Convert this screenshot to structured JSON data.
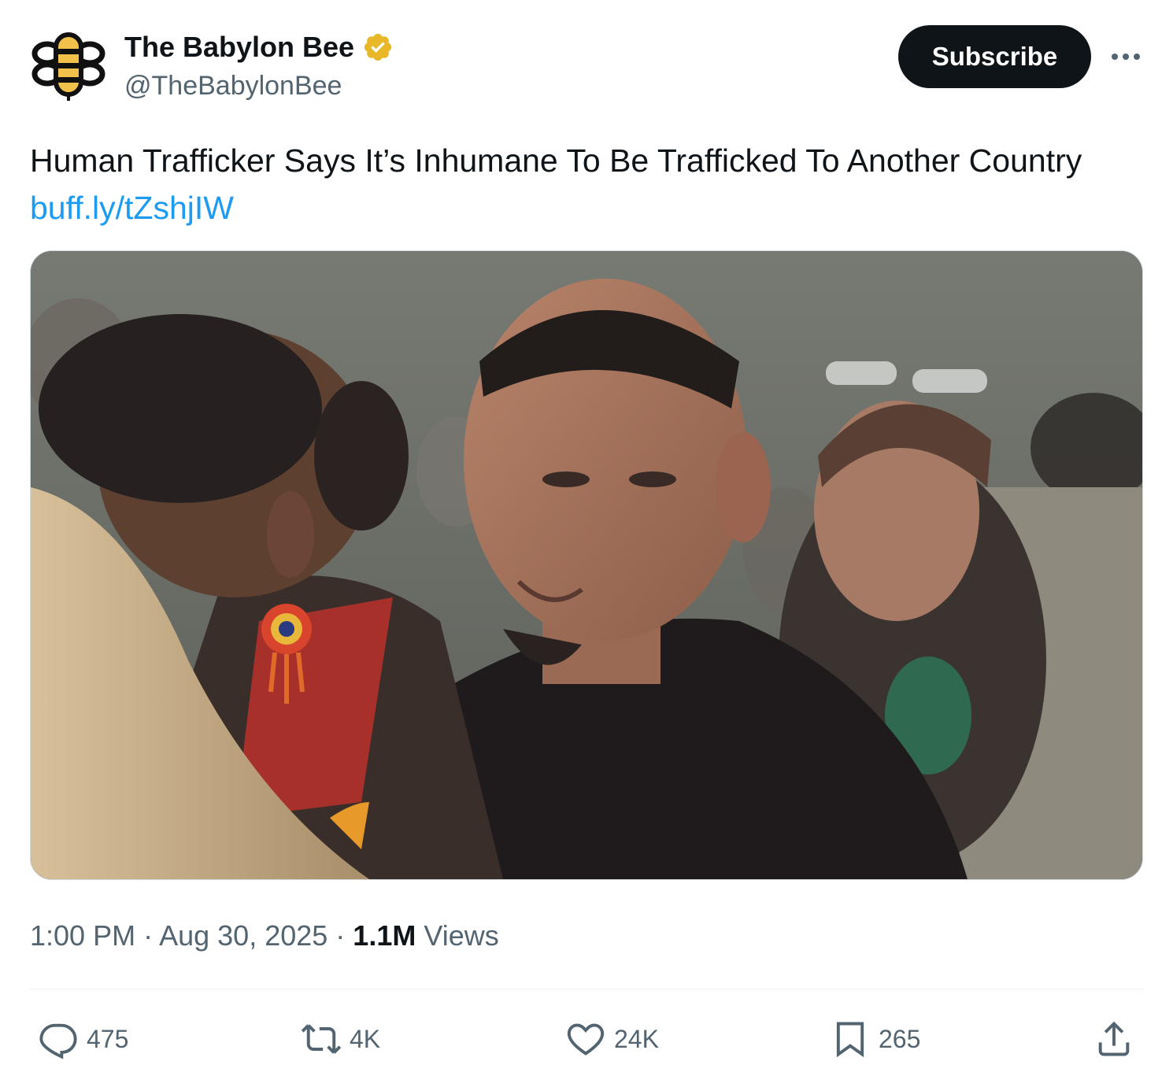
{
  "author": {
    "display_name": "The Babylon Bee",
    "handle": "@TheBabylonBee",
    "verified_color": "#e8b829",
    "avatar_icon": "bee-logo-icon"
  },
  "header": {
    "subscribe_label": "Subscribe",
    "more_icon": "more-horizontal-icon"
  },
  "tweet": {
    "text": "Human Trafficker Says It’s Inhumane To Be Trafficked To Another Country",
    "link": "buff.ly/tZshjIW",
    "link_color": "#1d9bf0"
  },
  "meta": {
    "time": "1:00 PM",
    "separator": " · ",
    "date": "Aug 30, 2025",
    "views_count": "1.1M",
    "views_label": " Views"
  },
  "actions": {
    "replies": {
      "icon": "reply-icon",
      "count": "475"
    },
    "reposts": {
      "icon": "repost-icon",
      "count": "4K"
    },
    "likes": {
      "icon": "heart-icon",
      "count": "24K"
    },
    "bookmarks": {
      "icon": "bookmark-icon",
      "count": "265"
    },
    "share": {
      "icon": "share-icon"
    }
  }
}
